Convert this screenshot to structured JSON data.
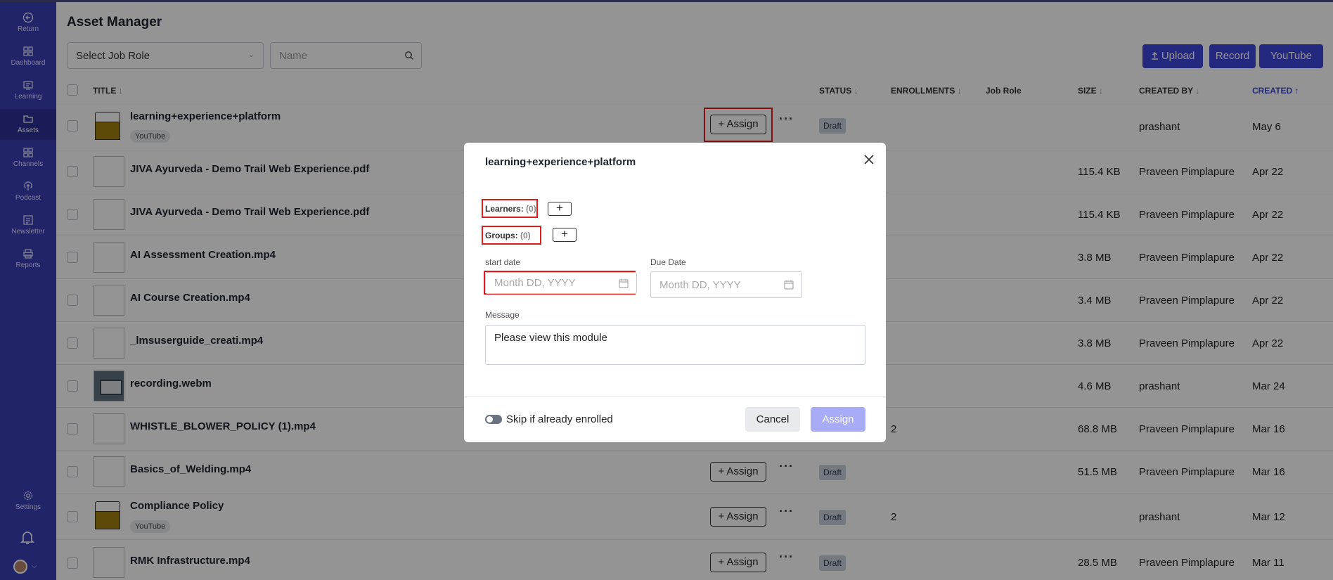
{
  "sidebar": {
    "items": [
      {
        "label": "Return",
        "icon": "return-icon"
      },
      {
        "label": "Dashboard",
        "icon": "dashboard-icon"
      },
      {
        "label": "Learning",
        "icon": "learning-icon"
      },
      {
        "label": "Assets",
        "icon": "assets-icon",
        "active": true
      },
      {
        "label": "Channels",
        "icon": "channels-icon"
      },
      {
        "label": "Podcast",
        "icon": "podcast-icon"
      },
      {
        "label": "Newsletter",
        "icon": "newsletter-icon"
      },
      {
        "label": "Reports",
        "icon": "reports-icon"
      }
    ],
    "settings_label": "Settings"
  },
  "header": {
    "title": "Asset Manager",
    "job_role_select": "Select Job Role",
    "name_placeholder": "Name",
    "upload_label": "Upload",
    "record_label": "Record",
    "youtube_label": "YouTube"
  },
  "table": {
    "columns": {
      "title": "TITLE",
      "status": "STATUS",
      "enrollments": "ENROLLMENTS",
      "job_role": "Job Role",
      "size": "SIZE",
      "created_by": "CREATED BY",
      "created": "CREATED"
    },
    "assign_label": "+ Assign",
    "draft_label": "Draft",
    "rows": [
      {
        "title": "learning+experience+platform",
        "badge": "YouTube",
        "status": "Draft",
        "enrollments": "",
        "size": "",
        "created_by": "prashant",
        "created": "May 6"
      },
      {
        "title": "JIVA Ayurveda - Demo Trail Web Experience.pdf",
        "size": "115.4 KB",
        "created_by": "Praveen Pimplapure",
        "created": "Apr 22"
      },
      {
        "title": "JIVA Ayurveda - Demo Trail Web Experience.pdf",
        "size": "115.4 KB",
        "created_by": "Praveen Pimplapure",
        "created": "Apr 22"
      },
      {
        "title": "AI Assessment Creation.mp4",
        "size": "3.8 MB",
        "created_by": "Praveen Pimplapure",
        "created": "Apr 22"
      },
      {
        "title": "AI Course Creation.mp4",
        "size": "3.4 MB",
        "created_by": "Praveen Pimplapure",
        "created": "Apr 22"
      },
      {
        "title": "_lmsuserguide_creati.mp4",
        "size": "3.8 MB",
        "created_by": "Praveen Pimplapure",
        "created": "Apr 22"
      },
      {
        "title": "recording.webm",
        "size": "4.6 MB",
        "created_by": "prashant",
        "created": "Mar 24"
      },
      {
        "title": "WHISTLE_BLOWER_POLICY (1).mp4",
        "enrollments": "2",
        "size": "68.8 MB",
        "created_by": "Praveen Pimplapure",
        "created": "Mar 16"
      },
      {
        "title": "Basics_of_Welding.mp4",
        "status": "Draft",
        "size": "51.5 MB",
        "created_by": "Praveen Pimplapure",
        "created": "Mar 16"
      },
      {
        "title": "Compliance Policy",
        "badge": "YouTube",
        "status": "Draft",
        "enrollments": "2",
        "created_by": "prashant",
        "created": "Mar 12"
      },
      {
        "title": "RMK Infrastructure.mp4",
        "status": "Draft",
        "size": "28.5 MB",
        "created_by": "Praveen Pimplapure",
        "created": "Mar 11"
      }
    ]
  },
  "modal": {
    "title": "learning+experience+platform",
    "learners_label": "Learners:",
    "learners_count": "(0)",
    "groups_label": "Groups:",
    "groups_count": "(0)",
    "start_date_label": "start date",
    "start_date_placeholder": "Month DD, YYYY",
    "due_date_label": "Due Date",
    "due_date_placeholder": "Month DD, YYYY",
    "message_label": "Message",
    "message_value": "Please view this module",
    "skip_label": "Skip if already enrolled",
    "cancel_label": "Cancel",
    "assign_label": "Assign"
  },
  "colors": {
    "sidebar": "#3b3fb6",
    "accent": "#3e46d9",
    "highlight": "#e01b1b"
  }
}
